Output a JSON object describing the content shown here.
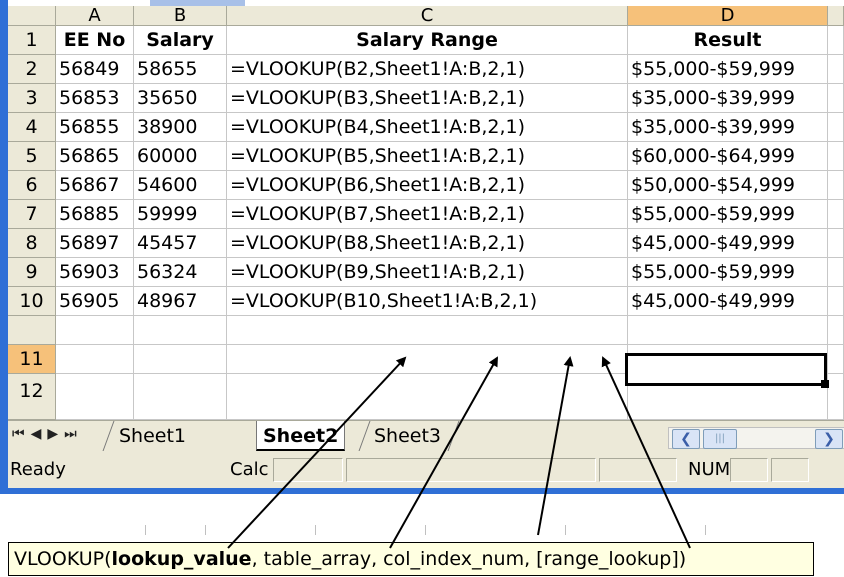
{
  "columns": [
    "A",
    "B",
    "C",
    "D"
  ],
  "headers": {
    "row_number": "1",
    "a": "EE No",
    "b": "Salary",
    "c": "Salary Range",
    "d": "Result"
  },
  "rows": [
    {
      "num": "2",
      "ee": "56849",
      "salary": "58655",
      "formula": "=VLOOKUP(B2,Sheet1!A:B,2,1)",
      "result": "$55,000-$59,999"
    },
    {
      "num": "3",
      "ee": "56853",
      "salary": "35650",
      "formula": "=VLOOKUP(B3,Sheet1!A:B,2,1)",
      "result": "$35,000-$39,999"
    },
    {
      "num": "4",
      "ee": "56855",
      "salary": "38900",
      "formula": "=VLOOKUP(B4,Sheet1!A:B,2,1)",
      "result": "$35,000-$39,999"
    },
    {
      "num": "5",
      "ee": "56865",
      "salary": "60000",
      "formula": "=VLOOKUP(B5,Sheet1!A:B,2,1)",
      "result": "$60,000-$64,999"
    },
    {
      "num": "6",
      "ee": "56867",
      "salary": "54600",
      "formula": "=VLOOKUP(B6,Sheet1!A:B,2,1)",
      "result": "$50,000-$54,999"
    },
    {
      "num": "7",
      "ee": "56885",
      "salary": "59999",
      "formula": "=VLOOKUP(B7,Sheet1!A:B,2,1)",
      "result": "$55,000-$59,999"
    },
    {
      "num": "8",
      "ee": "56897",
      "salary": "45457",
      "formula": "=VLOOKUP(B8,Sheet1!A:B,2,1)",
      "result": "$45,000-$49,999"
    },
    {
      "num": "9",
      "ee": "56903",
      "salary": "56324",
      "formula": "=VLOOKUP(B9,Sheet1!A:B,2,1)",
      "result": "$55,000-$59,999"
    },
    {
      "num": "10",
      "ee": "56905",
      "salary": "48967",
      "formula": "=VLOOKUP(B10,Sheet1!A:B,2,1)",
      "result": "$45,000-$49,999"
    }
  ],
  "empty_rows": [
    "11",
    "12"
  ],
  "sheet_tabs": [
    "Sheet1",
    "Sheet2",
    "Sheet3"
  ],
  "active_sheet": "Sheet2",
  "status": {
    "ready": "Ready",
    "calc": "Calc",
    "num": "NUM"
  },
  "tooltip": {
    "function_name": "VLOOKUP(",
    "arg1": "lookup_value",
    "rest": ", table_array, col_index_num, [range_lookup])"
  },
  "colors": {
    "frame": "#2f6fd6",
    "header_bg": "#ece9d8",
    "active_header": "#f6c17a",
    "tooltip_bg": "#ffffe1"
  },
  "icons": [
    "first-sheet-icon",
    "prev-sheet-icon",
    "next-sheet-icon",
    "last-sheet-icon",
    "scroll-left-icon",
    "scroll-right-icon"
  ]
}
